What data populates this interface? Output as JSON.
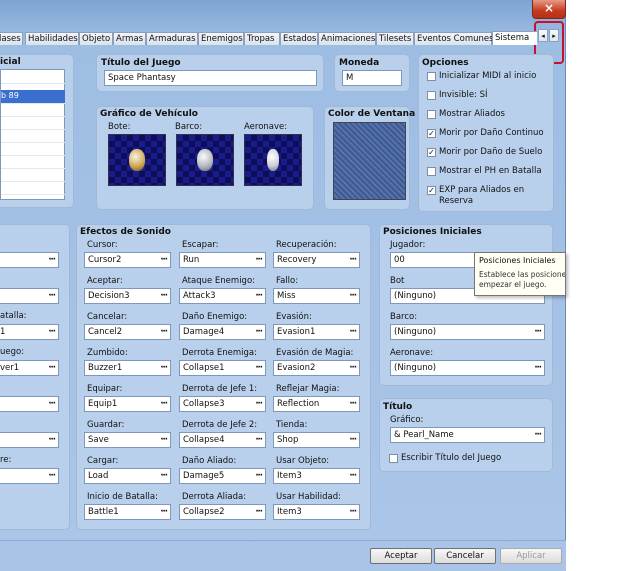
{
  "tabs": [
    "lases",
    "Habilidades",
    "Objeto",
    "Armas",
    "Armaduras",
    "Enemigos",
    "Tropas",
    "Estados",
    "Animaciones",
    "Tilesets",
    "Eventos Comunes",
    "Sistema"
  ],
  "close_symbol": "×",
  "arrows": {
    "left": "◂",
    "right": "▸"
  },
  "left_panel": {
    "title": "icial",
    "list": [
      "",
      "b 89",
      "",
      "",
      "",
      "",
      "",
      "",
      "",
      ""
    ]
  },
  "titulo": {
    "title": "Título del Juego",
    "value": "Space Phantasy"
  },
  "moneda": {
    "title": "Moneda",
    "value": "M"
  },
  "opciones": {
    "title": "Opciones",
    "items": [
      {
        "label": "Inicializar MIDI al inicio",
        "checked": false
      },
      {
        "label": "Invisible: SÍ",
        "checked": false
      },
      {
        "label": "Mostrar Aliados",
        "checked": false
      },
      {
        "label": "Morir por Daño Continuo",
        "checked": true
      },
      {
        "label": "Morir por Daño de Suelo",
        "checked": true
      },
      {
        "label": "Mostrar el PH en Batalla",
        "checked": false
      },
      {
        "label": "EXP para Aliados en",
        "label2": "Reserva",
        "checked": true
      }
    ]
  },
  "vehiculo": {
    "title": "Gráfico de Vehículo",
    "bote": "Bote:",
    "barco": "Barco:",
    "aeronave": "Aeronave:"
  },
  "color_ventana": {
    "title": "Color de Ventana"
  },
  "left_lower": {
    "labels": [
      "",
      "atalla:",
      "uego:",
      "",
      "",
      "re:"
    ],
    "values": [
      "",
      "",
      "1",
      "ver1",
      "",
      "",
      ""
    ]
  },
  "sonido": {
    "title": "Efectos de Sonido",
    "col1": [
      {
        "label": "Cursor:",
        "value": "Cursor2"
      },
      {
        "label": "Aceptar:",
        "value": "Decision3"
      },
      {
        "label": "Cancelar:",
        "value": "Cancel2"
      },
      {
        "label": "Zumbido:",
        "value": "Buzzer1"
      },
      {
        "label": "Equipar:",
        "value": "Equip1"
      },
      {
        "label": "Guardar:",
        "value": "Save"
      },
      {
        "label": "Cargar:",
        "value": "Load"
      },
      {
        "label": "Inicio de Batalla:",
        "value": "Battle1"
      }
    ],
    "col2": [
      {
        "label": "Escapar:",
        "value": "Run"
      },
      {
        "label": "Ataque Enemigo:",
        "value": "Attack3"
      },
      {
        "label": "Daño Enemigo:",
        "value": "Damage4"
      },
      {
        "label": "Derrota Enemiga:",
        "value": "Collapse1"
      },
      {
        "label": "Derrota de Jefe 1:",
        "value": "Collapse3"
      },
      {
        "label": "Derrota de Jefe 2:",
        "value": "Collapse4"
      },
      {
        "label": "Daño Aliado:",
        "value": "Damage5"
      },
      {
        "label": "Derrota Aliada:",
        "value": "Collapse2"
      }
    ],
    "col3": [
      {
        "label": "Recuperación:",
        "value": "Recovery"
      },
      {
        "label": "Fallo:",
        "value": "Miss"
      },
      {
        "label": "Evasión:",
        "value": "Evasion1"
      },
      {
        "label": "Evasión de Magia:",
        "value": "Evasion2"
      },
      {
        "label": "Reflejar Magia:",
        "value": "Reflection"
      },
      {
        "label": "Tienda:",
        "value": "Shop"
      },
      {
        "label": "Usar Objeto:",
        "value": "Item3"
      },
      {
        "label": "Usar Habilidad:",
        "value": "Item3"
      }
    ]
  },
  "posiciones": {
    "title": "Posiciones Iniciales",
    "jugador_label": "Jugador:",
    "jugador_value": "00",
    "bote_label": "Bot",
    "bote_value": "(Ninguno)",
    "barco_label": "Barco:",
    "barco_value": "(Ninguno)",
    "aeronave_label": "Aeronave:",
    "aeronave_value": "(Ninguno)"
  },
  "tooltip": {
    "title": "Posiciones Iniciales",
    "line1": "Establece las posiciones iniciales del jugador",
    "line2": "empezar el juego."
  },
  "titulo_panel": {
    "title": "Título",
    "grafico_label": "Gráfico:",
    "grafico_value": "& Pearl_Name",
    "check_label": "Escribir Título del Juego",
    "checked": false
  },
  "dots": "···",
  "buttons": {
    "aceptar": "Aceptar",
    "cancelar": "Cancelar",
    "aplicar": "Aplicar"
  }
}
